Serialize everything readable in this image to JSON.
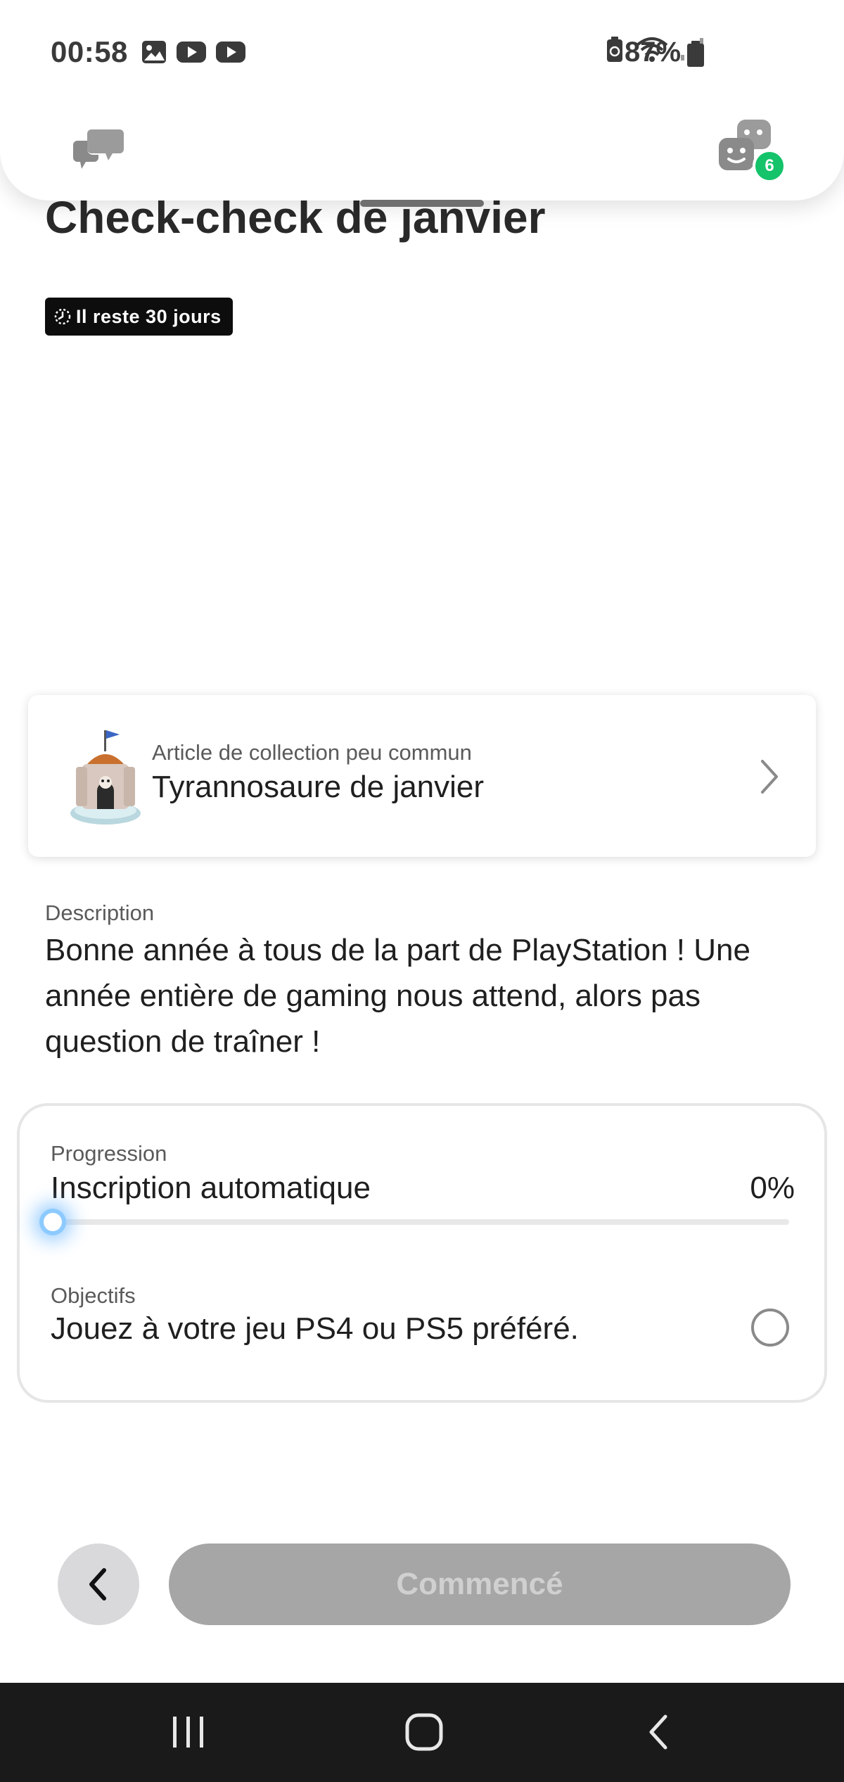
{
  "status_bar": {
    "time": "00:58",
    "battery": "87%",
    "left_icons": [
      "gallery-icon",
      "youtube-icon",
      "youtube-icon"
    ],
    "right_icons": [
      "battery-saver-icon",
      "wifi-icon",
      "signal-icon",
      "battery-icon"
    ]
  },
  "header": {
    "left_icon": "chat-bubbles-icon",
    "right_icon": "game-faces-icon",
    "notification_count": "6"
  },
  "challenge": {
    "title": "Check-check de janvier",
    "time_remaining": "Il reste 30 jours"
  },
  "reward": {
    "rarity_label": "Article de collection peu commun",
    "name": "Tyrannosaure de janvier"
  },
  "description": {
    "label": "Description",
    "text": "Bonne année à tous de la part de PlayStation ! Une année entière de gaming nous attend, alors pas question de traîner !"
  },
  "progress": {
    "label": "Progression",
    "title": "Inscription automatique",
    "percent_text": "0%",
    "percent_value": 0
  },
  "objectives": {
    "label": "Objectifs",
    "items": [
      {
        "text": "Jouez à votre jeu PS4 ou PS5 préféré.",
        "completed": false
      }
    ]
  },
  "actions": {
    "back_icon": "chevron-left-icon",
    "start_label": "Commencé"
  },
  "colors": {
    "badge": "#14c36a",
    "chip_bg": "#0d0d0d",
    "start_button_bg": "#a6a6a6",
    "progress_accent": "#6fb8ff"
  }
}
